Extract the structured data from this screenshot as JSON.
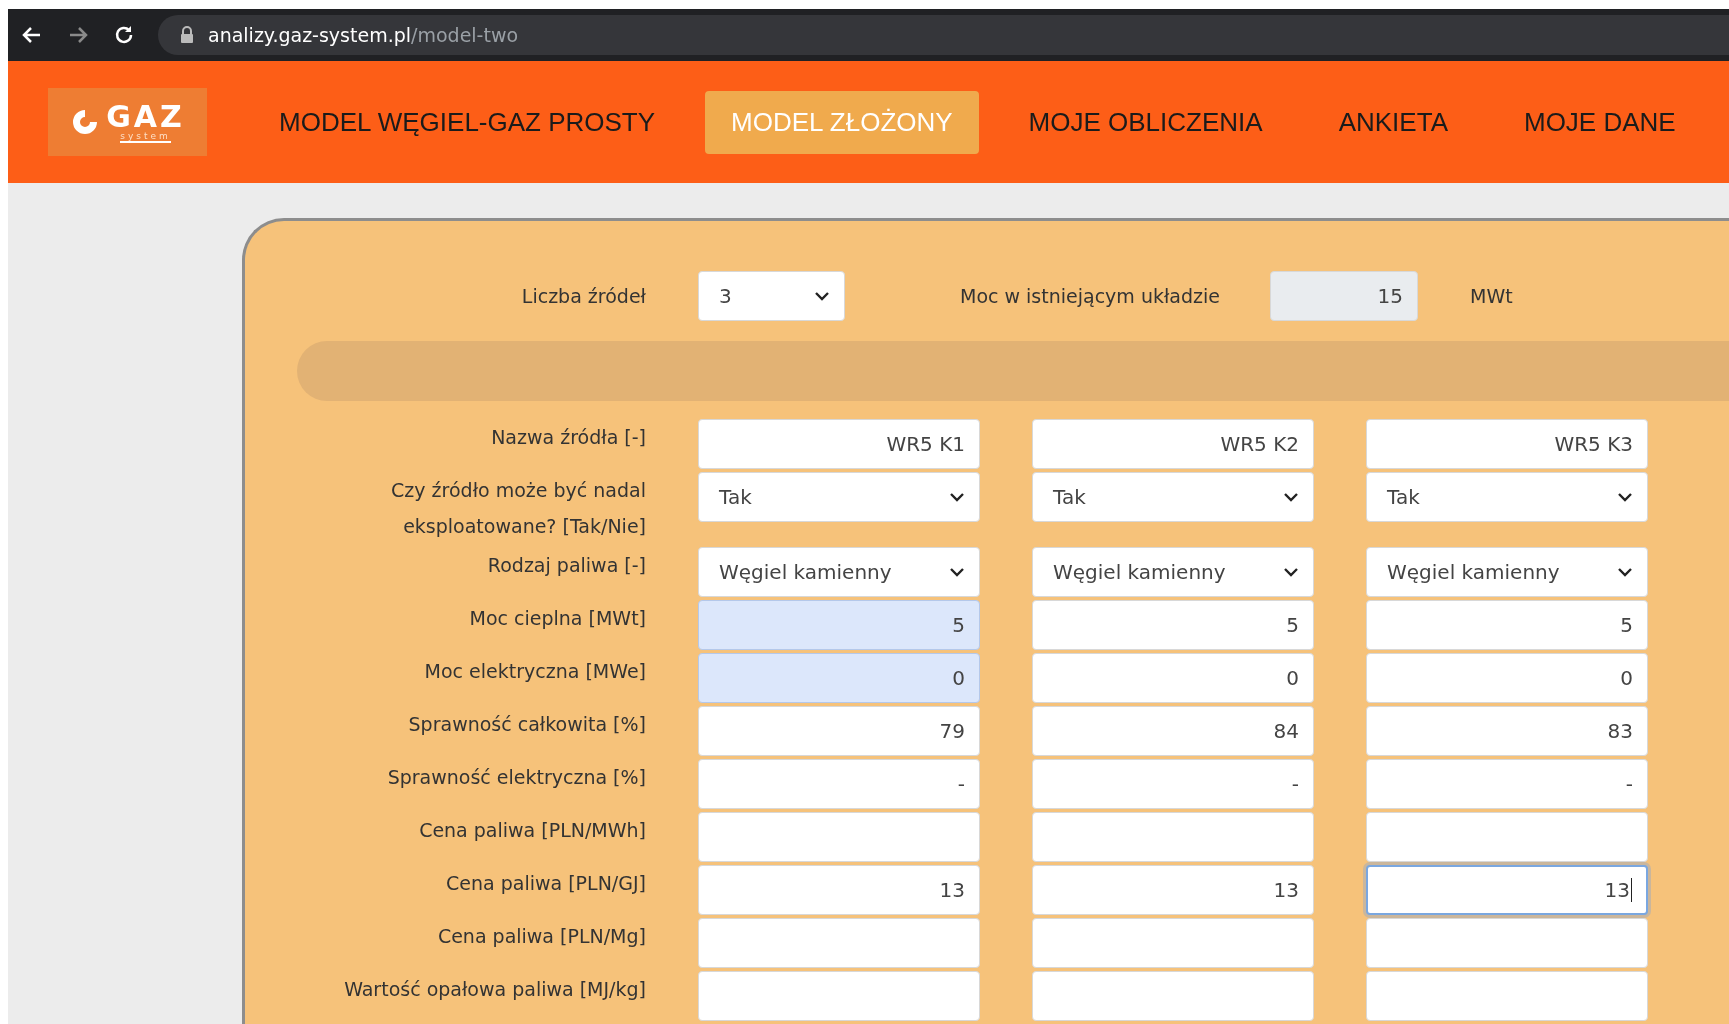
{
  "browser": {
    "url_host": "analizy.gaz-system.pl",
    "url_path": "/model-two"
  },
  "logo": {
    "text": "GAZ",
    "subtext": "system"
  },
  "nav": [
    {
      "label": "MODEL WĘGIEL-GAZ PROSTY",
      "selected": false
    },
    {
      "label": "MODEL ZŁOŻONY",
      "selected": true
    },
    {
      "label": "MOJE OBLICZENIA",
      "selected": false
    },
    {
      "label": "ANKIETA",
      "selected": false
    },
    {
      "label": "MOJE DANE",
      "selected": false
    }
  ],
  "top": {
    "sources_label": "Liczba źródeł",
    "sources_value": "3",
    "power_label": "Moc w istniejącym układzie",
    "power_value": "15",
    "power_unit": "MWt"
  },
  "rows": [
    {
      "label": "Nazwa źródła [-]",
      "kind": "text",
      "cells": [
        {
          "value": "WR5 K1",
          "autofilled": false,
          "focused": false
        },
        {
          "value": "WR5 K2",
          "autofilled": false,
          "focused": false
        },
        {
          "value": "WR5 K3",
          "autofilled": false,
          "focused": false
        }
      ]
    },
    {
      "label": "Czy źródło może być nadal eksploatowane? [Tak/Nie]",
      "kind": "select",
      "cells": [
        {
          "value": "Tak",
          "autofilled": false,
          "focused": false
        },
        {
          "value": "Tak",
          "autofilled": false,
          "focused": false
        },
        {
          "value": "Tak",
          "autofilled": false,
          "focused": false
        }
      ]
    },
    {
      "label": "Rodzaj paliwa [-]",
      "kind": "select",
      "cells": [
        {
          "value": "Węgiel kamienny",
          "autofilled": false,
          "focused": false
        },
        {
          "value": "Węgiel kamienny",
          "autofilled": false,
          "focused": false
        },
        {
          "value": "Węgiel kamienny",
          "autofilled": false,
          "focused": false
        }
      ]
    },
    {
      "label": "Moc cieplna [MWt]",
      "kind": "text",
      "cells": [
        {
          "value": "5",
          "autofilled": true,
          "focused": false
        },
        {
          "value": "5",
          "autofilled": false,
          "focused": false
        },
        {
          "value": "5",
          "autofilled": false,
          "focused": false
        }
      ]
    },
    {
      "label": "Moc elektryczna [MWe]",
      "kind": "text",
      "cells": [
        {
          "value": "0",
          "autofilled": true,
          "focused": false
        },
        {
          "value": "0",
          "autofilled": false,
          "focused": false
        },
        {
          "value": "0",
          "autofilled": false,
          "focused": false
        }
      ]
    },
    {
      "label": "Sprawność całkowita [%]",
      "kind": "text",
      "cells": [
        {
          "value": "79",
          "autofilled": false,
          "focused": false
        },
        {
          "value": "84",
          "autofilled": false,
          "focused": false
        },
        {
          "value": "83",
          "autofilled": false,
          "focused": false
        }
      ]
    },
    {
      "label": "Sprawność elektryczna [%]",
      "kind": "text",
      "cells": [
        {
          "value": "-",
          "autofilled": false,
          "focused": false
        },
        {
          "value": "-",
          "autofilled": false,
          "focused": false
        },
        {
          "value": "-",
          "autofilled": false,
          "focused": false
        }
      ]
    },
    {
      "label": "Cena paliwa [PLN/MWh]",
      "kind": "text",
      "cells": [
        {
          "autofilled": false,
          "focused": false
        },
        {
          "autofilled": false,
          "focused": false
        },
        {
          "autofilled": false,
          "focused": false
        }
      ]
    },
    {
      "label": "Cena paliwa [PLN/GJ]",
      "kind": "text",
      "cells": [
        {
          "value": "13",
          "autofilled": false,
          "focused": false
        },
        {
          "value": "13",
          "autofilled": false,
          "focused": false
        },
        {
          "value": "13",
          "autofilled": false,
          "focused": true
        }
      ]
    },
    {
      "label": "Cena paliwa [PLN/Mg]",
      "kind": "text",
      "cells": [
        {
          "autofilled": false,
          "focused": false
        },
        {
          "autofilled": false,
          "focused": false
        },
        {
          "autofilled": false,
          "focused": false
        }
      ]
    },
    {
      "label": "Wartość opałowa paliwa [MJ/kg]",
      "kind": "text",
      "cells": [
        {
          "autofilled": false,
          "focused": false
        },
        {
          "autofilled": false,
          "focused": false
        },
        {
          "autofilled": false,
          "focused": false
        }
      ]
    }
  ]
}
